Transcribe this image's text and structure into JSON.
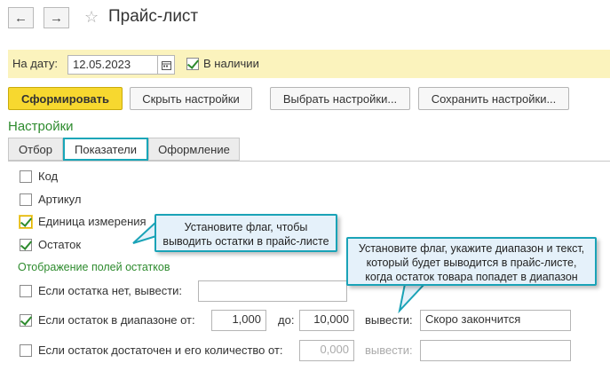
{
  "header": {
    "back_icon": "arrow-left-icon",
    "forward_icon": "arrow-right-icon",
    "star_icon": "star-icon",
    "title": "Прайс-лист"
  },
  "filter": {
    "date_label": "На дату:",
    "date_value": "12.05.2023",
    "calendar_icon": "calendar-icon",
    "in_stock_label": "В наличии",
    "in_stock_checked": true
  },
  "toolbar": {
    "generate": "Сформировать",
    "hide_settings": "Скрыть настройки",
    "choose_settings": "Выбрать настройки...",
    "save_settings": "Сохранить настройки..."
  },
  "settings": {
    "title": "Настройки",
    "tabs": [
      {
        "label": "Отбор",
        "active": false
      },
      {
        "label": "Показатели",
        "active": true
      },
      {
        "label": "Оформление",
        "active": false
      }
    ],
    "fields": [
      {
        "label": "Код",
        "checked": false
      },
      {
        "label": "Артикул",
        "checked": false
      },
      {
        "label": "Единица измерения",
        "checked": true
      },
      {
        "label": "Остаток",
        "checked": true
      }
    ],
    "stock_display": {
      "title": "Отображение полей остатков",
      "none_label": "Если остатка нет, вывести:",
      "none_checked": false,
      "none_value": "",
      "range_label": "Если остаток в диапазоне от:",
      "range_checked": true,
      "range_from": "1,000",
      "range_to_label": "до:",
      "range_to": "10,000",
      "range_output_label": "вывести:",
      "range_output_value": "Скоро закончится",
      "enough_label": "Если остаток достаточен и его количество от:",
      "enough_checked": false,
      "enough_from": "0,000",
      "enough_output_label": "вывести:",
      "enough_output_value": ""
    }
  },
  "callouts": {
    "unit_hint": "Установите флаг, чтобы выводить остатки в прайс-листе",
    "range_hint": "Установите флаг, укажите диапазон и текст, который будет выводится в прайс-листе, когда остаток товара попадет в диапазон"
  },
  "colors": {
    "accent_green": "#2e8b2e",
    "highlight_teal": "#18a6b8",
    "primary_button": "#f7d82f",
    "filter_bar": "#fbf3bd"
  }
}
